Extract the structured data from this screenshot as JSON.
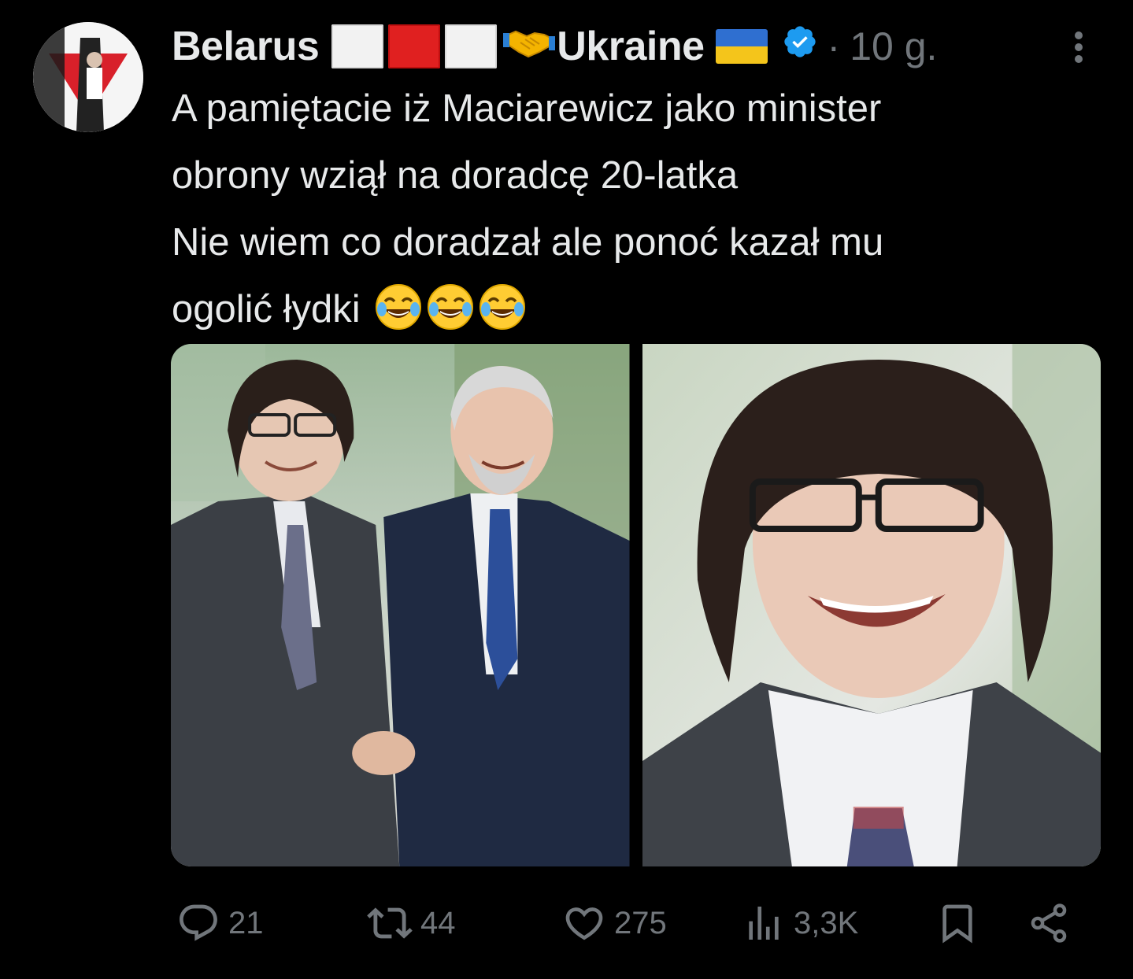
{
  "author": {
    "display_name": "Belarus",
    "display_name_suffix": "Ukraine",
    "flag_by_colors": [
      "#f2f2f2",
      "#e02020",
      "#f2f2f2"
    ],
    "flag_ua_colors": [
      "#2f6fd0",
      "#f4c51b"
    ],
    "verified_color": "#1d9bf0",
    "verified_icon": "verified-badge-icon",
    "handshake_icon": "handshake-emoji",
    "avatar_icon": "avatar-image"
  },
  "meta": {
    "separator": "·",
    "time": "10 g."
  },
  "more_icon": "more-options-icon",
  "tweet": {
    "lines": [
      "A pamiętacie iż Maciarewicz jako minister",
      "obrony wziął na doradcę 20-latka",
      "Nie wiem co doradzał ale ponoć kazał mu",
      "ogolić łydki"
    ],
    "trailing_emoji": [
      "tears-of-joy-emoji",
      "tears-of-joy-emoji",
      "tears-of-joy-emoji"
    ]
  },
  "media": [
    {
      "icon": "photo-two-men-handshake"
    },
    {
      "icon": "photo-young-man-portrait"
    }
  ],
  "actions": {
    "reply": {
      "icon": "reply-icon",
      "count": "21"
    },
    "repost": {
      "icon": "repost-icon",
      "count": "44"
    },
    "like": {
      "icon": "heart-icon",
      "count": "275"
    },
    "views": {
      "icon": "views-icon",
      "count": "3,3K"
    },
    "bookmark": {
      "icon": "bookmark-icon"
    },
    "share": {
      "icon": "share-icon"
    }
  },
  "colors": {
    "background": "#000000",
    "text": "#e7e9ea",
    "secondary": "#71767b"
  }
}
